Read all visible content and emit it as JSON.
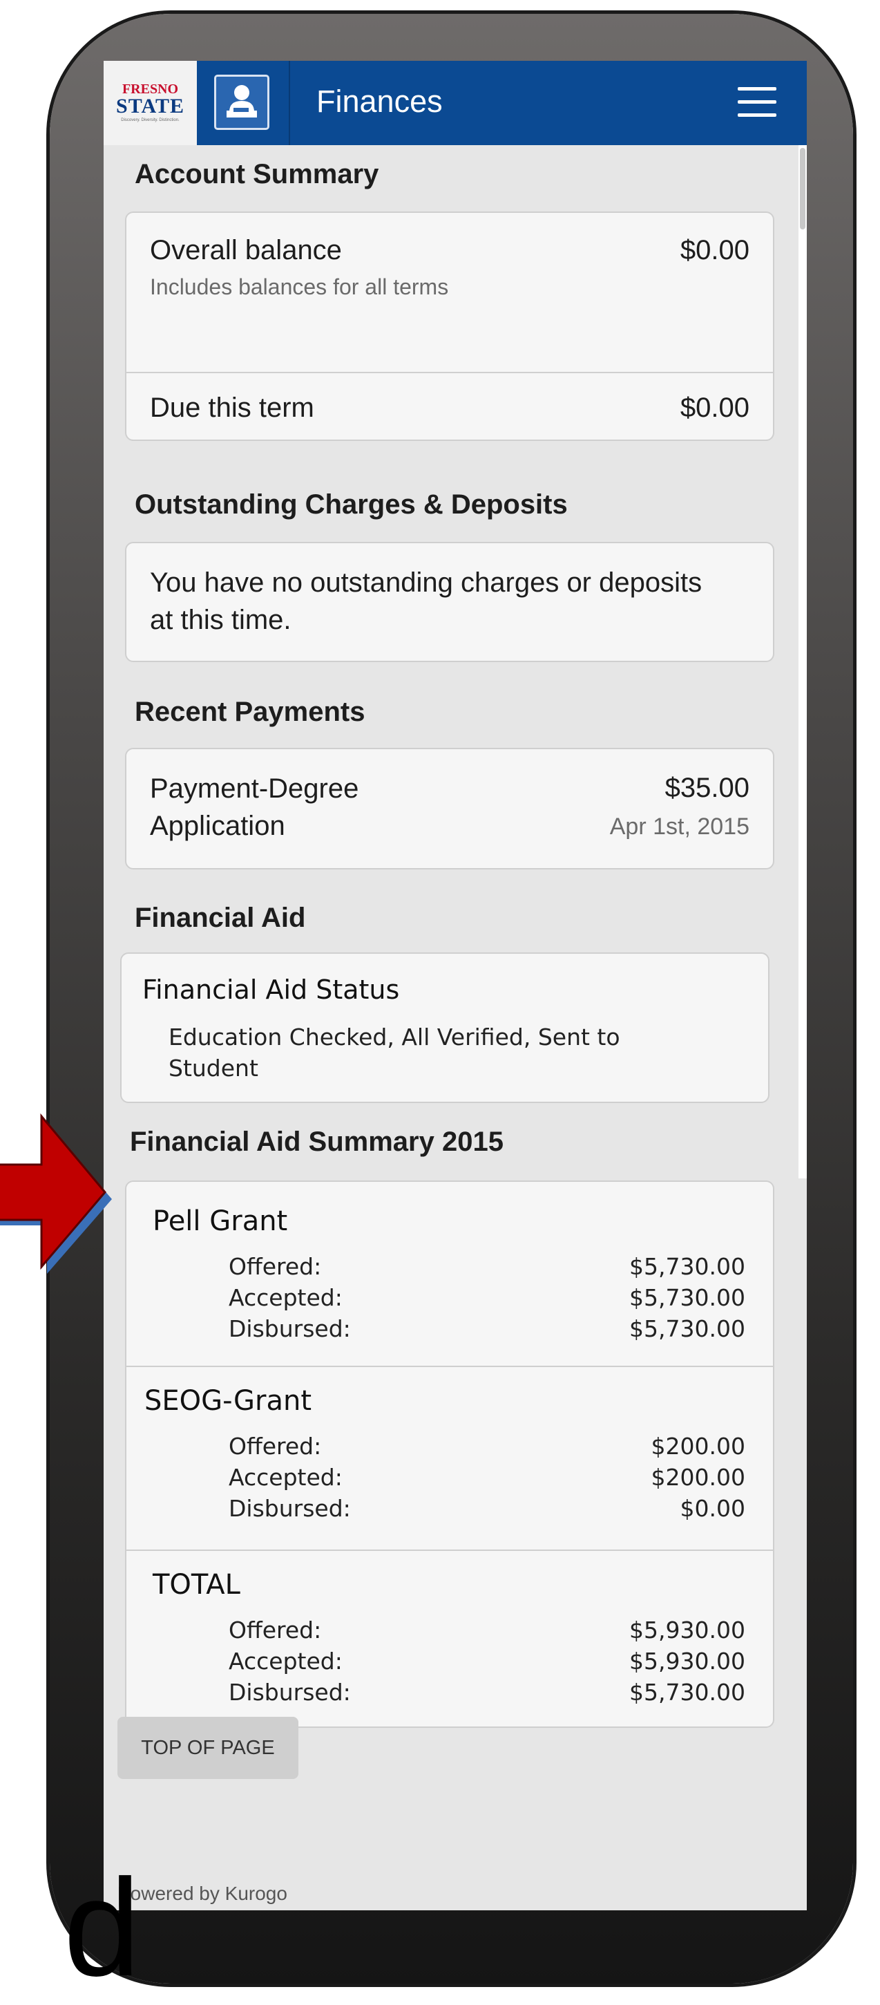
{
  "header": {
    "logo_line1": "FRESNO",
    "logo_line2": "STATE",
    "logo_tagline": "Discovery. Diversity. Distinction.",
    "title": "Finances"
  },
  "account_summary": {
    "title": "Account Summary",
    "overall_label": "Overall balance",
    "overall_sub": "Includes balances for all terms",
    "overall_amount": "$0.00",
    "due_label": "Due this term",
    "due_amount": "$0.00"
  },
  "outstanding": {
    "title": "Outstanding Charges & Deposits",
    "message": "You have no outstanding charges or deposits at this time."
  },
  "recent_payments": {
    "title": "Recent Payments",
    "items": [
      {
        "label": "Payment-Degree Application",
        "amount": "$35.00",
        "date": "Apr 1st, 2015"
      }
    ]
  },
  "financial_aid": {
    "title": "Financial Aid",
    "status_label": "Financial Aid Status",
    "status_detail": "Education Checked, All Verified, Sent to Student"
  },
  "aid_summary": {
    "title": "Financial Aid Summary 2015",
    "groups": [
      {
        "name": "Pell Grant",
        "lines": [
          {
            "label": "Offered:",
            "value": "$5,730.00"
          },
          {
            "label": "Accepted:",
            "value": "$5,730.00"
          },
          {
            "label": "Disbursed:",
            "value": "$5,730.00"
          }
        ]
      },
      {
        "name": "SEOG-Grant",
        "lines": [
          {
            "label": "Offered:",
            "value": "$200.00"
          },
          {
            "label": "Accepted:",
            "value": "$200.00"
          },
          {
            "label": "Disbursed:",
            "value": "$0.00"
          }
        ]
      },
      {
        "name": "TOTAL",
        "lines": [
          {
            "label": "Offered:",
            "value": "$5,930.00"
          },
          {
            "label": "Accepted:",
            "value": "$5,930.00"
          },
          {
            "label": "Disbursed:",
            "value": "$5,730.00"
          }
        ]
      }
    ]
  },
  "footer": {
    "top_button": "TOP OF PAGE",
    "powered_by": "Powered by Kurogo"
  },
  "overlay": {
    "arrow_color": "#c00000",
    "letter": "d"
  },
  "colors": {
    "header_bg": "#0b4a93",
    "page_bg": "#e6e6e6",
    "card_bg": "#f6f6f6"
  }
}
